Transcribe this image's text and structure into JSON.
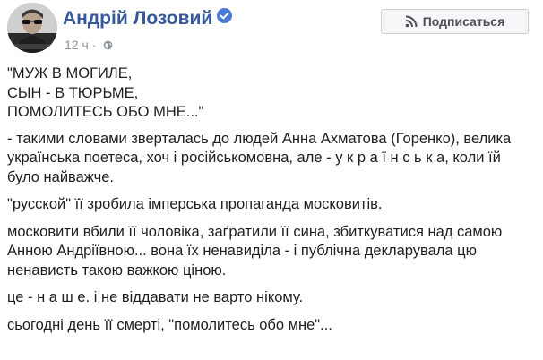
{
  "post": {
    "author": "Андрій Лозовий",
    "time": "12 ч",
    "privacy_icon": "globe-icon",
    "verified_icon": "verified-badge-icon",
    "subscribe_icon": "rss-icon",
    "subscribe_label": "Подписаться",
    "quote_lines": [
      "\"МУЖ В МОГИЛЕ,",
      "СЫН - В ТЮРЬМЕ,",
      "ПОМОЛИТЕСЬ ОБО МНЕ...\""
    ],
    "paragraphs": [
      "- такими словами зверталась до людей Анна Ахматова (Горенко), велика українська поетеса, хоч і російськомовна, але - у к р а ї н с ь к а, коли їй було найважче.",
      "\"русской\" її зробила імперська пропаганда московитів.",
      "московити вбили її чоловіка, заґратили її сина, збиткуватися над самою Анною Андріївною... вона їх ненавиділа - і публічна декларувала цю ненависть такою важкою ціною.",
      "це - н а ш е. і не віддавати не варто нікому.",
      "сьогодні день її смерті, \"помолитесь обо мне\"..."
    ]
  },
  "colors": {
    "author_link": "#365899",
    "meta_gray": "#90949c",
    "text": "#1c1e21",
    "verified": "#4a7ad6",
    "button_bg": "#f5f6f7",
    "button_border": "#ccd0d5"
  }
}
